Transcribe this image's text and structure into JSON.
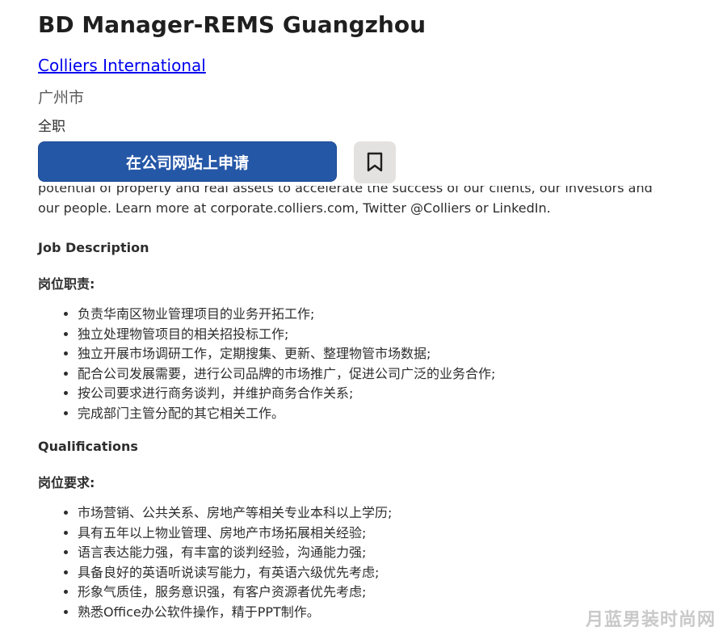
{
  "job": {
    "title": "BD Manager-REMS Guangzhou",
    "company": "Colliers International",
    "location": "广州市",
    "type": "全职"
  },
  "actions": {
    "apply_label": "在公司网站上申请",
    "save_icon": "bookmark-icon"
  },
  "description": {
    "intro_partial": "potential of property and real assets to accelerate the success of our clients, our investors and our people. Learn more at corporate.colliers.com, Twitter @Colliers or LinkedIn.",
    "job_description_heading": "Job Description",
    "responsibilities_heading": "岗位职责:",
    "responsibilities": [
      "负责华南区物业管理项目的业务开拓工作;",
      "独立处理物管项目的相关招投标工作;",
      "独立开展市场调研工作，定期搜集、更新、整理物管市场数据;",
      "配合公司发展需要，进行公司品牌的市场推广，促进公司广泛的业务合作;",
      "按公司要求进行商务谈判，并维护商务合作关系;",
      "完成部门主管分配的其它相关工作。"
    ],
    "qualifications_heading": "Qualifications",
    "requirements_heading": "岗位要求:",
    "requirements": [
      "市场营销、公共关系、房地产等相关专业本科以上学历;",
      "具有五年以上物业管理、房地产市场拓展相关经验;",
      "语言表达能力强，有丰富的谈判经验，沟通能力强;",
      "具备良好的英语听说读写能力，有英语六级优先考虑;",
      "形象气质佳，服务意识强，有客户资源者优先考虑;",
      "熟悉Office办公软件操作，精于PPT制作。"
    ]
  },
  "watermark": "月蓝男装时尚网",
  "colors": {
    "apply_button": "#2557a7",
    "save_button": "#e4e2e0",
    "link": "#0000ee",
    "text": "#2d2d2d"
  }
}
